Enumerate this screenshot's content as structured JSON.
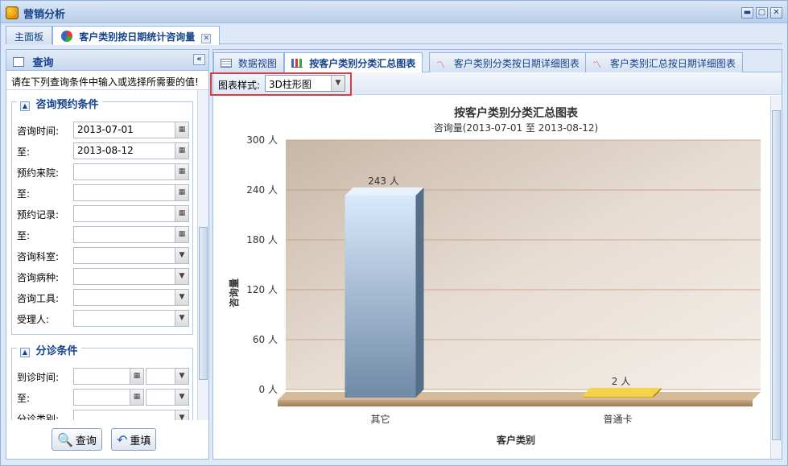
{
  "window": {
    "title": "营销分析",
    "controls": [
      "▬",
      "▢",
      "✕"
    ]
  },
  "top_tabs": [
    {
      "label": "主面板"
    },
    {
      "label": "客户类别按日期统计咨询量",
      "close": "✕"
    }
  ],
  "left_panel": {
    "title": "查询",
    "collapse": "«",
    "hint": "请在下列查询条件中输入或选择所需要的值!",
    "section1": {
      "title": "咨询预约条件",
      "toggle": "▲",
      "fields": [
        {
          "label": "咨询时间:",
          "value": "2013-07-01"
        },
        {
          "label": "至:",
          "value": "2013-08-12"
        },
        {
          "label": "预约来院:",
          "value": ""
        },
        {
          "label": "至:",
          "value": ""
        },
        {
          "label": "预约记录:",
          "value": ""
        },
        {
          "label": "至:",
          "value": ""
        },
        {
          "label": "咨询科室:",
          "value": ""
        },
        {
          "label": "咨询病种:",
          "value": ""
        },
        {
          "label": "咨询工具:",
          "value": ""
        },
        {
          "label": "受理人:",
          "value": ""
        }
      ]
    },
    "section2": {
      "title": "分诊条件",
      "toggle": "▲",
      "fields": [
        {
          "label": "到诊时间:"
        },
        {
          "label": "至:"
        },
        {
          "label": "分诊类别:"
        }
      ]
    },
    "buttons": {
      "query": "查询",
      "reset": "重填"
    }
  },
  "right_panel": {
    "tabs": [
      {
        "label": "数据视图"
      },
      {
        "label": "按客户类别分类汇总图表"
      },
      {
        "label": "客户类别分类按日期详细图表"
      },
      {
        "label": "客户类别汇总按日期详细图表"
      }
    ],
    "toolbar": {
      "label": "图表样式:",
      "value": "3D柱形图"
    }
  },
  "chart_data": {
    "type": "bar",
    "title": "按客户类别分类汇总图表",
    "subtitle": "咨询量(2013-07-01 至 2013-08-12)",
    "xlabel": "客户类别",
    "ylabel": "咨询量",
    "categories": [
      "其它",
      "普通卡"
    ],
    "values": [
      243,
      2
    ],
    "value_labels": [
      "243 人",
      "2 人"
    ],
    "yticks": [
      "0 人",
      "60 人",
      "120 人",
      "180 人",
      "240 人",
      "300 人"
    ],
    "ylim": [
      0,
      300
    ],
    "colors": [
      "#a9c7e8",
      "#e8b820"
    ]
  }
}
